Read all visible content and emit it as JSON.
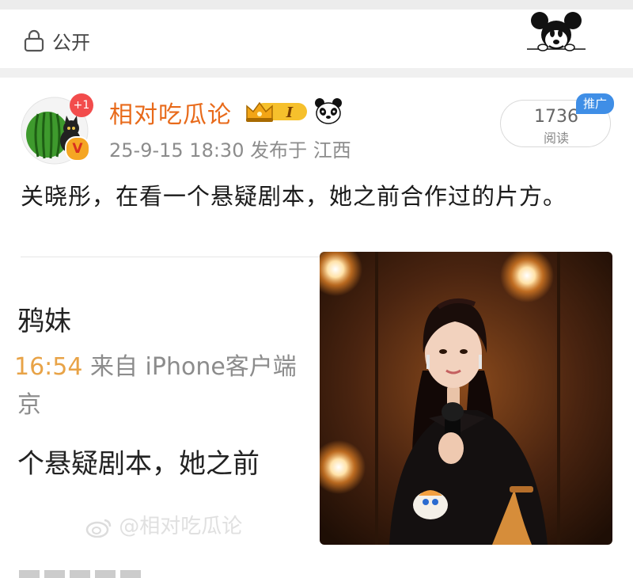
{
  "header": {
    "visibility_icon": "lock-icon",
    "visibility_label": "公开",
    "decoration_icon": "mickey-mouse-icon"
  },
  "post": {
    "author": {
      "name": "相对吃瓜论",
      "avatar_icon": "watermelon-avatar",
      "plus_badge": "+1",
      "verified_badge": "V",
      "level_badge": "I",
      "level_icon": "crown-icon",
      "extra_icon": "panda-icon"
    },
    "time": "25-9-15 18:30",
    "location": "发布于 江西",
    "reads": {
      "count": "1736",
      "label": "阅读"
    },
    "promo_tag": "推广",
    "text": "关晓彤，在看一个悬疑剧本，她之前合作过的片方。",
    "embedded_screenshot": {
      "line1": "鸦妹",
      "time_fragment": "16:54",
      "source": " 来自 iPhone客户端",
      "line3": "京",
      "line4": "个悬疑剧本，她之前",
      "watermark": "@相对吃瓜论"
    },
    "photo": {
      "subject_icon": "woman-with-microphone-photo"
    }
  },
  "colors": {
    "author_name": "#e86a1a",
    "promo_badge": "#3f8ee6",
    "plus_badge": "#f24c4c",
    "meta_text": "#8c8c8c"
  }
}
